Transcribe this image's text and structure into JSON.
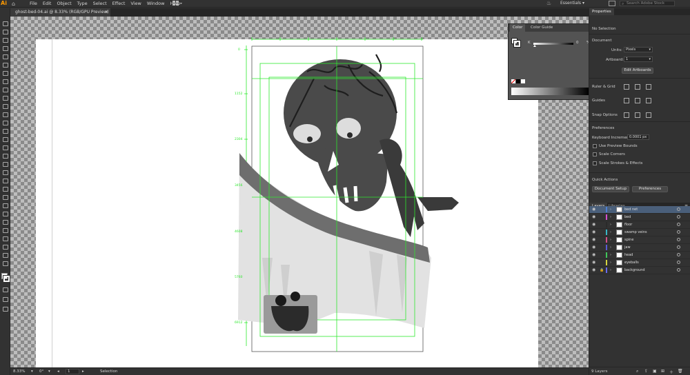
{
  "app": {
    "logo": "Ai",
    "menus": [
      "File",
      "Edit",
      "Object",
      "Type",
      "Select",
      "Effect",
      "View",
      "Window",
      "Help"
    ],
    "workspace": "Essentials",
    "stock_placeholder": "Search Adobe Stock"
  },
  "document": {
    "tab_title": "ghost-bed-04.ai @ 8.33% (RGB/GPU Preview)",
    "tab_close": "×"
  },
  "ruler": {
    "labels": [
      "0",
      "1152",
      "2304",
      "3456",
      "4608",
      "5760",
      "6912"
    ]
  },
  "status": {
    "zoom": "8.33%",
    "angle": "0°",
    "artboard": "1",
    "tool": "Selection"
  },
  "color_panel": {
    "tabs": [
      "Color",
      "Color Guide"
    ],
    "k_label": "K",
    "k_value": "0",
    "k_unit": "%"
  },
  "properties": {
    "tab": "Properties",
    "no_selection": "No Selection",
    "document_heading": "Document",
    "units_label": "Units:",
    "units_value": "Pixels",
    "artboard_label": "Artboard:",
    "artboard_value": "1",
    "edit_artboards": "Edit Artboards",
    "ruler_grid": "Ruler & Grid",
    "guides": "Guides",
    "snap_options": "Snap Options",
    "preferences_heading": "Preferences",
    "keyboard_increment_label": "Keyboard Increment:",
    "keyboard_increment_value": "0.0001 px",
    "use_preview_bounds": "Use Preview Bounds",
    "scale_corners": "Scale Corners",
    "scale_strokes": "Scale Strokes & Effects",
    "quick_actions": "Quick Actions",
    "document_setup": "Document Setup",
    "preferences_button": "Preferences"
  },
  "layers_panel": {
    "tabs": [
      "Layers",
      "Libraries"
    ],
    "count": "9 Layers",
    "layers": [
      {
        "name": "bed net",
        "color": "#4f7fd1",
        "selected": true,
        "locked": false
      },
      {
        "name": "bed",
        "color": "#d64fd1",
        "selected": false,
        "locked": false
      },
      {
        "name": "floor",
        "color": "#2a2a2a",
        "selected": false,
        "locked": false
      },
      {
        "name": "swamp veins",
        "color": "#38b8c8",
        "selected": false,
        "locked": false
      },
      {
        "name": "spine",
        "color": "#d64f8a",
        "selected": false,
        "locked": false
      },
      {
        "name": "jaw",
        "color": "#5a5ad6",
        "selected": false,
        "locked": false
      },
      {
        "name": "head",
        "color": "#3fc85a",
        "selected": false,
        "locked": false
      },
      {
        "name": "eyeballs",
        "color": "#d6d63f",
        "selected": false,
        "locked": false
      },
      {
        "name": "background",
        "color": "#6a6af0",
        "selected": false,
        "locked": true
      }
    ]
  },
  "colors": {
    "accent_orange": "#ff9a00",
    "guide_green": "#2ee82e",
    "selection_blue": "#4a5f7a"
  }
}
